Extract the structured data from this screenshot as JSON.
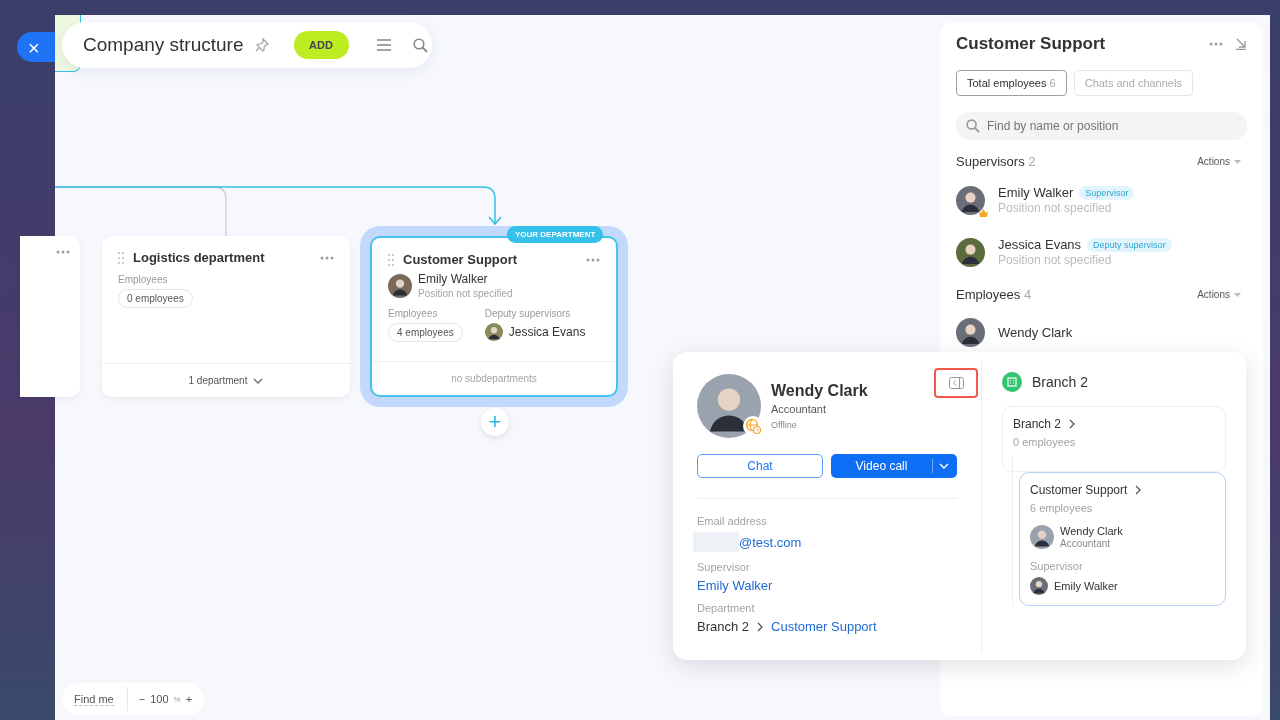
{
  "close_button": {
    "label": "×"
  },
  "header": {
    "title": "Company structure",
    "add_button": "ADD"
  },
  "departments": [
    {
      "title": "Logistics department",
      "highlighted": false,
      "employees_label": "Employees",
      "employees_count": "0 employees",
      "footer": "1 department",
      "footer_expandable": true
    },
    {
      "title": "Customer Support",
      "highlighted": true,
      "badge": "YOUR DEPARTMENT",
      "head": {
        "name": "Emily Walker",
        "position": "Position not specified"
      },
      "employees_label": "Employees",
      "employees_count": "4 employees",
      "deputy_label": "Deputy supervisors",
      "deputy": "Jessica Evans",
      "footer": "no subdepartments",
      "footer_expandable": false
    }
  ],
  "add_subdepartment": "+",
  "zoom": {
    "find_me": "Find me",
    "minus": "−",
    "value": "100",
    "unit": "%",
    "plus": "+"
  },
  "panel": {
    "title": "Customer Support",
    "tabs": [
      {
        "label": "Total employees",
        "count": "6",
        "selected": true
      },
      {
        "label": "Chats and channels",
        "selected": false
      }
    ],
    "search": {
      "placeholder": "Find by name or position"
    },
    "sections": [
      {
        "title": "Supervisors",
        "count": "2",
        "actions": "Actions",
        "people": [
          {
            "name": "Emily Walker",
            "role": "Supervisor",
            "position": "Position not specified",
            "crown": true
          },
          {
            "name": "Jessica Evans",
            "role": "Deputy supervisor",
            "position": "Position not specified",
            "crown": false
          }
        ]
      },
      {
        "title": "Employees",
        "count": "4",
        "actions": "Actions",
        "people": [
          {
            "name": "Wendy Clark",
            "crown": false
          }
        ]
      }
    ]
  },
  "popup": {
    "name": "Wendy Clark",
    "position": "Accountant",
    "status": "Offline",
    "collapse_highlighted": true,
    "chat": "Chat",
    "video_call": "Video call",
    "fields": [
      {
        "label": "Email address",
        "kind": "email",
        "value": "@test.com"
      },
      {
        "label": "Supervisor",
        "kind": "link",
        "value": "Emily Walker"
      },
      {
        "label": "Department",
        "kind": "path",
        "parent": "Branch 2",
        "value": "Customer Support"
      }
    ],
    "tree": {
      "title": "Branch 2",
      "root": {
        "name": "Branch 2",
        "count": "0 employees",
        "children": [
          {
            "name": "Customer Support",
            "count": "6 employees",
            "person": {
              "name": "Wendy Clark",
              "position": "Accountant"
            },
            "supervisor_label": "Supervisor",
            "supervisor": "Emily Walker"
          }
        ]
      }
    }
  }
}
